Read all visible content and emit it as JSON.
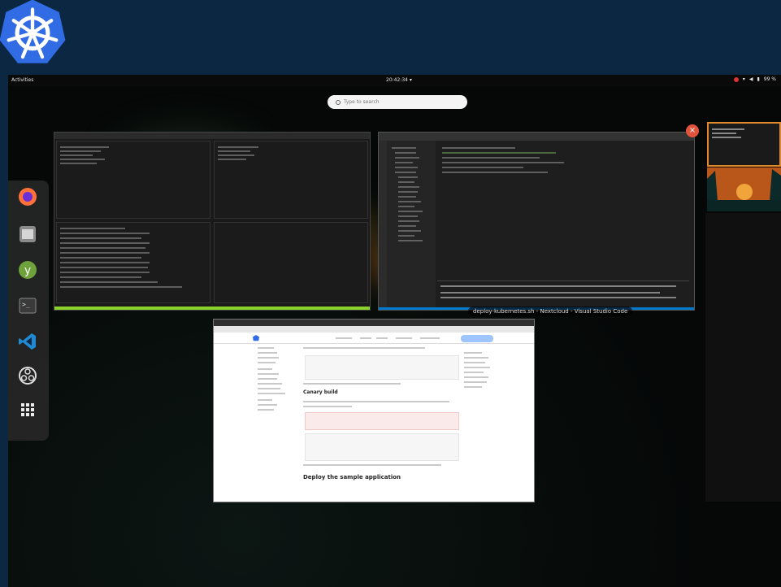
{
  "topbar": {
    "activities_label": "Activities",
    "clock": "20:42:34 ▾",
    "battery": "99 %"
  },
  "search": {
    "placeholder": "Type to search"
  },
  "dock": {
    "items": [
      {
        "name": "firefox-icon"
      },
      {
        "name": "files-icon"
      },
      {
        "name": "yed-icon"
      },
      {
        "name": "terminal-icon"
      },
      {
        "name": "vscode-icon"
      },
      {
        "name": "obs-icon"
      },
      {
        "name": "app-grid-icon"
      }
    ]
  },
  "windows": {
    "vscode_caption": "deploy-kubernetes.sh - Nextcloud - Visual Studio Code",
    "browser_heading": "Deploy the sample application",
    "browser_subheading": "Canary build"
  },
  "colors": {
    "accent_green": "#8bd22a",
    "close_badge": "#e2533c",
    "kubernetes_blue": "#326ce5"
  }
}
